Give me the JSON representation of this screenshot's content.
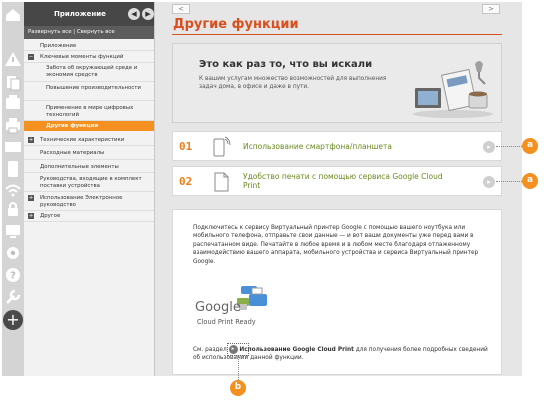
{
  "nav": {
    "title": "Приложение",
    "expand_all": "Развернуть все",
    "separator": "|",
    "collapse_all": "Свернуть все",
    "items": [
      {
        "label": "Приложение",
        "toggle": ""
      },
      {
        "label": "Ключевые моменты функций",
        "toggle": "−"
      },
      {
        "label": "Забота об окружающей среде и экономия средств",
        "toggle": ""
      },
      {
        "label": "Повышение производительности",
        "toggle": ""
      },
      {
        "label": "Применение в мире цифровых технологий",
        "toggle": ""
      },
      {
        "label": "Другие функции",
        "toggle": ""
      },
      {
        "label": "Технические характеристики",
        "toggle": "+"
      },
      {
        "label": "Расходные материалы",
        "toggle": ""
      },
      {
        "label": "Дополнительные элементы",
        "toggle": ""
      },
      {
        "label": "Руководства, входящие в комплект поставки устройства",
        "toggle": ""
      },
      {
        "label": "Использование Электронное руководство",
        "toggle": "+"
      },
      {
        "label": "Другое",
        "toggle": "+"
      }
    ]
  },
  "icons": [
    "home-icon",
    "warning-icon",
    "copy-icon",
    "fax-icon",
    "print-icon",
    "scan-icon",
    "device-icon",
    "wifi-icon",
    "lock-icon",
    "screen-icon",
    "gear-icon",
    "help-icon",
    "wrench-icon",
    "plus-icon"
  ],
  "page": {
    "title": "Другие функции",
    "prev": "<",
    "next": ">"
  },
  "banner": {
    "title": "Это как раз то, что вы искали",
    "subtitle": "К вашим услугам множество возможностей для выполнения задач дома, в офисе и даже в пути."
  },
  "cards": [
    {
      "num": "01",
      "text": "Использование смартфона/планшета"
    },
    {
      "num": "02",
      "text": "Удобство печати с помощью сервиса Google Cloud Print"
    }
  ],
  "callouts": {
    "a": "a",
    "b": "b"
  },
  "info": {
    "para": "Подключитесь к сервису Виртуальный принтер Google с помощью вашего ноутбука или мобильного телефона, отправьте свои данные — и вот ваши документы уже перед вами в распечатанном виде. Печатайте в любое время и в любом месте благодаря отлаженному взаимодействию вашего аппарата, мобильного устройства и сервиса Виртуальный принтер Google.",
    "logo_text": "Google",
    "logo_sub": "Cloud Print Ready",
    "ref_pre": "См. раздел",
    "ref_link": "Использование Google Cloud Print",
    "ref_post": "для получения более подробных сведений об использовании данной функции."
  },
  "colors": {
    "accent": "#f39020",
    "title": "#d94f1e",
    "link": "#6a8a1f"
  }
}
